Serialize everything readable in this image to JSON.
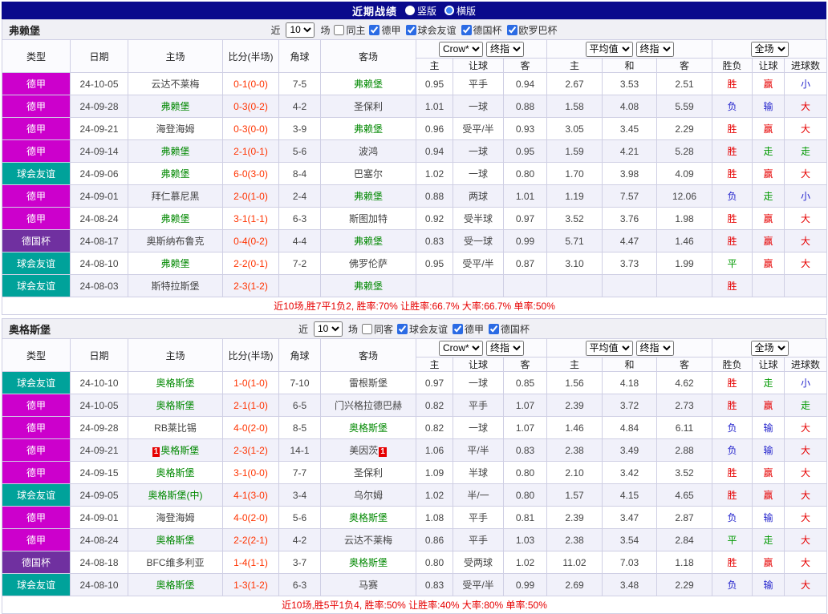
{
  "topbar": {
    "title": "近期战绩",
    "radios": [
      {
        "label": "竖版",
        "checked": false
      },
      {
        "label": "横版",
        "checked": true
      }
    ]
  },
  "colors": {
    "topbarBg": "#0a0a8c",
    "radioDot": "#3b82f6",
    "checkAccent": "#2b6be4",
    "border": "#cfcfe4",
    "rowAlt": "#f1f1fa",
    "headerBg": "#fbfbfe",
    "titleBg": "#f0f0f5",
    "focusTeam": "#008800",
    "score": "#ff3300",
    "resRed": "#e60000",
    "resGreen": "#009900",
    "resBlue": "#2222cc",
    "summary": "#e60000",
    "badgeRed": "#e60000"
  },
  "leagueColorMap": {
    "德甲": "#cc00cc",
    "球会友谊": "#00a29a",
    "德国杯": "#7030a0"
  },
  "resultColorMap": {
    "胜": "red",
    "平": "green",
    "负": "blue",
    "赢": "red",
    "走": "green",
    "输": "blue",
    "大": "red",
    "小": "blue"
  },
  "table": {
    "mainHeaders": [
      "类型",
      "日期",
      "主场",
      "比分(半场)",
      "角球",
      "客场"
    ],
    "subHeaders": [
      "主",
      "让球",
      "客",
      "主",
      "和",
      "客",
      "胜负",
      "让球",
      "进球数"
    ]
  },
  "sections": [
    {
      "team": "弗赖堡",
      "filters": {
        "recentLabel": "近",
        "recentValue": "10",
        "fieldLabel": "场",
        "sameLabel": "同主",
        "sameChecked": false,
        "leagues": [
          {
            "label": "德甲",
            "checked": true
          },
          {
            "label": "球会友谊",
            "checked": true
          },
          {
            "label": "德国杯",
            "checked": true
          },
          {
            "label": "欧罗巴杯",
            "checked": true
          }
        ]
      },
      "selects": {
        "odds": "Crow*",
        "oddsIndex": "终指",
        "avg": "平均值",
        "avgIndex": "终指",
        "full": "全场"
      },
      "rows": [
        {
          "league": "德甲",
          "date": "24-10-05",
          "home": {
            "name": "云达不莱梅"
          },
          "score": "0-1(0-0)",
          "corner": "7-5",
          "away": {
            "name": "弗赖堡",
            "focus": true
          },
          "asia": [
            "0.95",
            "平手",
            "0.94"
          ],
          "euro": [
            "2.67",
            "3.53",
            "2.51"
          ],
          "result": [
            "胜",
            "赢",
            "小"
          ]
        },
        {
          "league": "德甲",
          "date": "24-09-28",
          "home": {
            "name": "弗赖堡",
            "focus": true
          },
          "score": "0-3(0-2)",
          "corner": "4-2",
          "away": {
            "name": "圣保利"
          },
          "asia": [
            "1.01",
            "一球",
            "0.88"
          ],
          "euro": [
            "1.58",
            "4.08",
            "5.59"
          ],
          "result": [
            "负",
            "输",
            "大"
          ]
        },
        {
          "league": "德甲",
          "date": "24-09-21",
          "home": {
            "name": "海登海姆"
          },
          "score": "0-3(0-0)",
          "corner": "3-9",
          "away": {
            "name": "弗赖堡",
            "focus": true
          },
          "asia": [
            "0.96",
            "受平/半",
            "0.93"
          ],
          "euro": [
            "3.05",
            "3.45",
            "2.29"
          ],
          "result": [
            "胜",
            "赢",
            "大"
          ]
        },
        {
          "league": "德甲",
          "date": "24-09-14",
          "home": {
            "name": "弗赖堡",
            "focus": true
          },
          "score": "2-1(0-1)",
          "corner": "5-6",
          "away": {
            "name": "波鸿"
          },
          "asia": [
            "0.94",
            "一球",
            "0.95"
          ],
          "euro": [
            "1.59",
            "4.21",
            "5.28"
          ],
          "result": [
            "胜",
            "走",
            "走"
          ]
        },
        {
          "league": "球会友谊",
          "date": "24-09-06",
          "home": {
            "name": "弗赖堡",
            "focus": true
          },
          "score": "6-0(3-0)",
          "corner": "8-4",
          "away": {
            "name": "巴塞尔"
          },
          "asia": [
            "1.02",
            "一球",
            "0.80"
          ],
          "euro": [
            "1.70",
            "3.98",
            "4.09"
          ],
          "result": [
            "胜",
            "赢",
            "大"
          ]
        },
        {
          "league": "德甲",
          "date": "24-09-01",
          "home": {
            "name": "拜仁慕尼黑"
          },
          "score": "2-0(1-0)",
          "corner": "2-4",
          "away": {
            "name": "弗赖堡",
            "focus": true
          },
          "asia": [
            "0.88",
            "两球",
            "1.01"
          ],
          "euro": [
            "1.19",
            "7.57",
            "12.06"
          ],
          "result": [
            "负",
            "走",
            "小"
          ]
        },
        {
          "league": "德甲",
          "date": "24-08-24",
          "home": {
            "name": "弗赖堡",
            "focus": true
          },
          "score": "3-1(1-1)",
          "corner": "6-3",
          "away": {
            "name": "斯图加特"
          },
          "asia": [
            "0.92",
            "受半球",
            "0.97"
          ],
          "euro": [
            "3.52",
            "3.76",
            "1.98"
          ],
          "result": [
            "胜",
            "赢",
            "大"
          ]
        },
        {
          "league": "德国杯",
          "date": "24-08-17",
          "home": {
            "name": "奥斯纳布鲁克"
          },
          "score": "0-4(0-2)",
          "corner": "4-4",
          "away": {
            "name": "弗赖堡",
            "focus": true
          },
          "asia": [
            "0.83",
            "受一球",
            "0.99"
          ],
          "euro": [
            "5.71",
            "4.47",
            "1.46"
          ],
          "result": [
            "胜",
            "赢",
            "大"
          ]
        },
        {
          "league": "球会友谊",
          "date": "24-08-10",
          "home": {
            "name": "弗赖堡",
            "focus": true
          },
          "score": "2-2(0-1)",
          "corner": "7-2",
          "away": {
            "name": "佛罗伦萨"
          },
          "asia": [
            "0.95",
            "受平/半",
            "0.87"
          ],
          "euro": [
            "3.10",
            "3.73",
            "1.99"
          ],
          "result": [
            "平",
            "赢",
            "大"
          ]
        },
        {
          "league": "球会友谊",
          "date": "24-08-03",
          "home": {
            "name": "斯特拉斯堡"
          },
          "score": "2-3(1-2)",
          "corner": "",
          "away": {
            "name": "弗赖堡",
            "focus": true
          },
          "asia": [
            "",
            "",
            ""
          ],
          "euro": [
            "",
            "",
            ""
          ],
          "result": [
            "胜",
            "",
            ""
          ]
        }
      ],
      "summary": "近10场,胜7平1负2, 胜率:70% 让胜率:66.7% 大率:66.7% 单率:50%"
    },
    {
      "team": "奥格斯堡",
      "filters": {
        "recentLabel": "近",
        "recentValue": "10",
        "fieldLabel": "场",
        "sameLabel": "同客",
        "sameChecked": false,
        "leagues": [
          {
            "label": "球会友谊",
            "checked": true
          },
          {
            "label": "德甲",
            "checked": true
          },
          {
            "label": "德国杯",
            "checked": true
          }
        ]
      },
      "selects": {
        "odds": "Crow*",
        "oddsIndex": "终指",
        "avg": "平均值",
        "avgIndex": "终指",
        "full": "全场"
      },
      "rows": [
        {
          "league": "球会友谊",
          "date": "24-10-10",
          "home": {
            "name": "奥格斯堡",
            "focus": true
          },
          "score": "1-0(1-0)",
          "corner": "7-10",
          "away": {
            "name": "雷根斯堡"
          },
          "asia": [
            "0.97",
            "一球",
            "0.85"
          ],
          "euro": [
            "1.56",
            "4.18",
            "4.62"
          ],
          "result": [
            "胜",
            "走",
            "小"
          ]
        },
        {
          "league": "德甲",
          "date": "24-10-05",
          "home": {
            "name": "奥格斯堡",
            "focus": true
          },
          "score": "2-1(1-0)",
          "corner": "6-5",
          "away": {
            "name": "门兴格拉德巴赫"
          },
          "asia": [
            "0.82",
            "平手",
            "1.07"
          ],
          "euro": [
            "2.39",
            "3.72",
            "2.73"
          ],
          "result": [
            "胜",
            "赢",
            "走"
          ]
        },
        {
          "league": "德甲",
          "date": "24-09-28",
          "home": {
            "name": "RB莱比锡"
          },
          "score": "4-0(2-0)",
          "corner": "8-5",
          "away": {
            "name": "奥格斯堡",
            "focus": true
          },
          "asia": [
            "0.82",
            "一球",
            "1.07"
          ],
          "euro": [
            "1.46",
            "4.84",
            "6.11"
          ],
          "result": [
            "负",
            "输",
            "大"
          ]
        },
        {
          "league": "德甲",
          "date": "24-09-21",
          "home": {
            "name": "奥格斯堡",
            "focus": true,
            "pre": "1"
          },
          "score": "2-3(1-2)",
          "corner": "14-1",
          "away": {
            "name": "美因茨",
            "post": "1"
          },
          "asia": [
            "1.06",
            "平/半",
            "0.83"
          ],
          "euro": [
            "2.38",
            "3.49",
            "2.88"
          ],
          "result": [
            "负",
            "输",
            "大"
          ]
        },
        {
          "league": "德甲",
          "date": "24-09-15",
          "home": {
            "name": "奥格斯堡",
            "focus": true
          },
          "score": "3-1(0-0)",
          "corner": "7-7",
          "away": {
            "name": "圣保利"
          },
          "asia": [
            "1.09",
            "半球",
            "0.80"
          ],
          "euro": [
            "2.10",
            "3.42",
            "3.52"
          ],
          "result": [
            "胜",
            "赢",
            "大"
          ]
        },
        {
          "league": "球会友谊",
          "date": "24-09-05",
          "home": {
            "name": "奥格斯堡(中)",
            "focus": true
          },
          "score": "4-1(3-0)",
          "corner": "3-4",
          "away": {
            "name": "乌尔姆"
          },
          "asia": [
            "1.02",
            "半/一",
            "0.80"
          ],
          "euro": [
            "1.57",
            "4.15",
            "4.65"
          ],
          "result": [
            "胜",
            "赢",
            "大"
          ]
        },
        {
          "league": "德甲",
          "date": "24-09-01",
          "home": {
            "name": "海登海姆"
          },
          "score": "4-0(2-0)",
          "corner": "5-6",
          "away": {
            "name": "奥格斯堡",
            "focus": true
          },
          "asia": [
            "1.08",
            "平手",
            "0.81"
          ],
          "euro": [
            "2.39",
            "3.47",
            "2.87"
          ],
          "result": [
            "负",
            "输",
            "大"
          ]
        },
        {
          "league": "德甲",
          "date": "24-08-24",
          "home": {
            "name": "奥格斯堡",
            "focus": true
          },
          "score": "2-2(2-1)",
          "corner": "4-2",
          "away": {
            "name": "云达不莱梅"
          },
          "asia": [
            "0.86",
            "平手",
            "1.03"
          ],
          "euro": [
            "2.38",
            "3.54",
            "2.84"
          ],
          "result": [
            "平",
            "走",
            "大"
          ]
        },
        {
          "league": "德国杯",
          "date": "24-08-18",
          "home": {
            "name": "BFC维多利亚"
          },
          "score": "1-4(1-1)",
          "corner": "3-7",
          "away": {
            "name": "奥格斯堡",
            "focus": true
          },
          "asia": [
            "0.80",
            "受两球",
            "1.02"
          ],
          "euro": [
            "11.02",
            "7.03",
            "1.18"
          ],
          "result": [
            "胜",
            "赢",
            "大"
          ]
        },
        {
          "league": "球会友谊",
          "date": "24-08-10",
          "home": {
            "name": "奥格斯堡",
            "focus": true
          },
          "score": "1-3(1-2)",
          "corner": "6-3",
          "away": {
            "name": "马赛"
          },
          "asia": [
            "0.83",
            "受平/半",
            "0.99"
          ],
          "euro": [
            "2.69",
            "3.48",
            "2.29"
          ],
          "result": [
            "负",
            "输",
            "大"
          ]
        }
      ],
      "summary": "近10场,胜5平1负4, 胜率:50% 让胜率:40% 大率:80% 单率:50%"
    }
  ]
}
